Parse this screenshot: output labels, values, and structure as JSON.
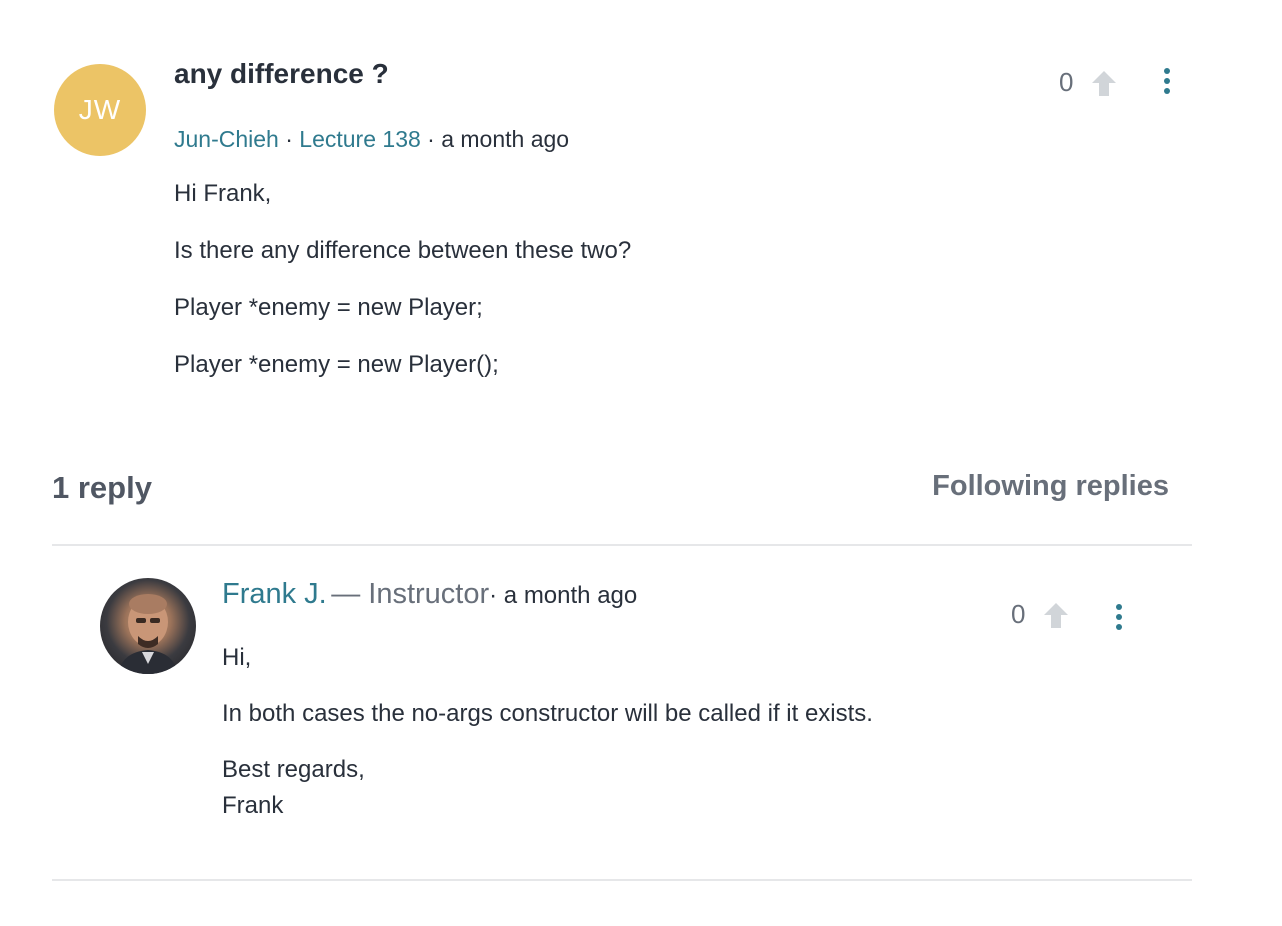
{
  "question": {
    "avatar_initials": "JW",
    "title": "any difference ?",
    "author": "Jun-Chieh",
    "lecture": "Lecture 138",
    "separator": "·",
    "time": "· a month ago",
    "votes": "0",
    "body": [
      "Hi Frank,",
      "Is there any difference between these two?",
      "Player *enemy = new Player;",
      "Player *enemy = new Player();"
    ]
  },
  "replies_header": {
    "count_label": "1 reply",
    "following_label": "Following replies"
  },
  "reply": {
    "author": "Frank J.",
    "role": "— Instructor",
    "time": "· a month ago",
    "votes": "0",
    "body": [
      "Hi,",
      "In both cases the no-args constructor will be called if it exists.",
      "Best regards,",
      "Frank"
    ]
  },
  "colors": {
    "accent": "#2f7a8e",
    "avatar_bg": "#ecc466",
    "muted": "#686f7a"
  }
}
